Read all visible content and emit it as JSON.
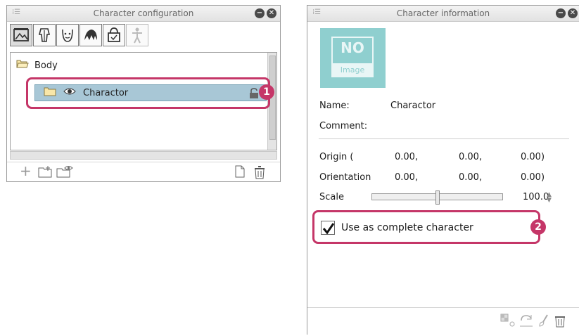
{
  "colors": {
    "accent": "#c53668",
    "selection": "#a8c7d6",
    "thumbnail": "#8fcfcf"
  },
  "left_panel": {
    "title": "Character configuration",
    "toolbar_icons": [
      "background-icon",
      "costume-icon",
      "face-icon",
      "hair-icon",
      "accessory-icon",
      "pose-figure-icon"
    ],
    "tree": {
      "folder_label": "Body",
      "selected_item_label": "Charactor"
    },
    "bottom_icons": [
      "add-icon",
      "new-folder-icon",
      "new-folder-visible-icon",
      "new-page-icon",
      "delete-icon"
    ],
    "callout_number": "1"
  },
  "right_panel": {
    "title": "Character information",
    "thumbnail": {
      "top_text": "NO",
      "bottom_text": "Image"
    },
    "name_label": "Name:",
    "name_value": "Charactor",
    "comment_label": "Comment:",
    "origin_label": "Origin (",
    "origin_values": [
      "0.00,",
      "0.00,",
      "0.00)"
    ],
    "orientation_label": "Orientation",
    "orientation_values": [
      "0.00,",
      "0.00,",
      "0.00)"
    ],
    "scale_label": "Scale",
    "scale_value": "100.0",
    "scale_slider_fraction": 0.5,
    "checkbox_label": "Use as complete character",
    "checkbox_checked": true,
    "callout_number": "2",
    "footer_icons": [
      "texture-icon",
      "refresh-icon",
      "brush-icon",
      "delete-icon"
    ]
  }
}
